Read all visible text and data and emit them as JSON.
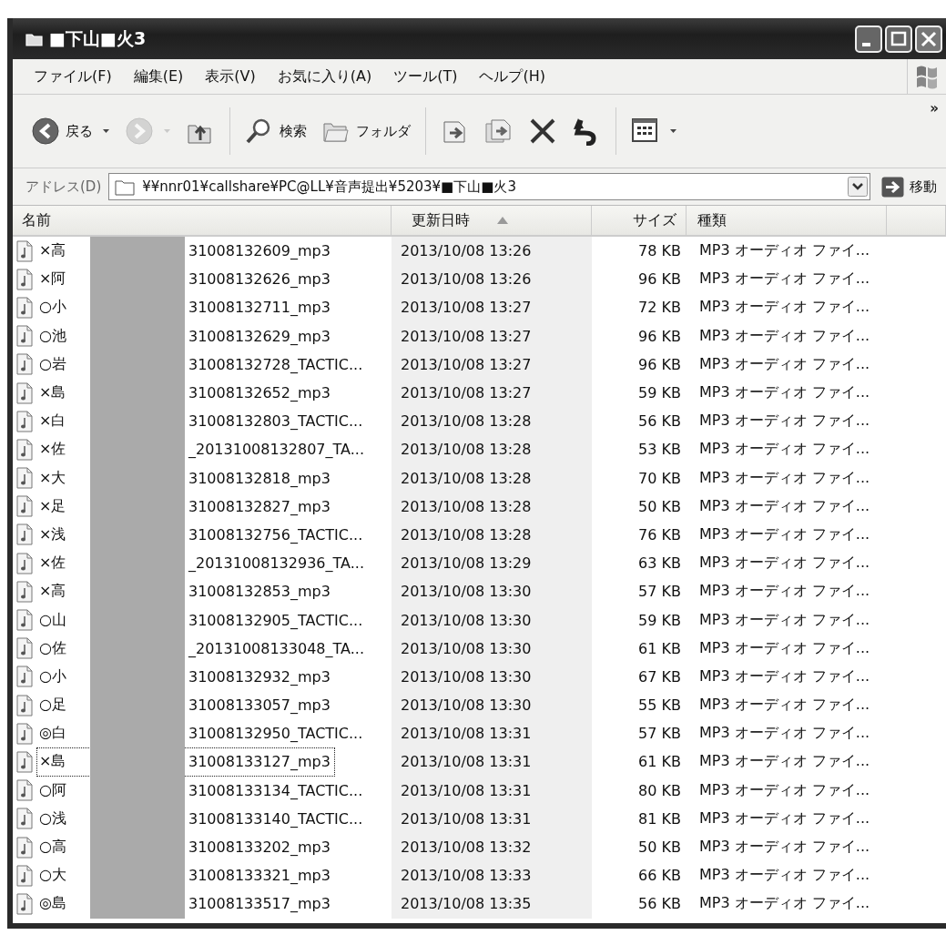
{
  "window": {
    "title": "■下山■火3"
  },
  "menu": [
    {
      "label": "ファイル(F)"
    },
    {
      "label": "編集(E)"
    },
    {
      "label": "表示(V)"
    },
    {
      "label": "お気に入り(A)"
    },
    {
      "label": "ツール(T)"
    },
    {
      "label": "ヘルプ(H)"
    }
  ],
  "toolbar": {
    "buttons": [
      {
        "kind": "back",
        "label": "戻る",
        "disabled": false
      },
      {
        "kind": "forward",
        "disabled": true
      },
      {
        "kind": "up",
        "disabled": false
      },
      {
        "kind": "separator"
      },
      {
        "kind": "search",
        "label": "検索",
        "disabled": false
      },
      {
        "kind": "folders",
        "label": "フォルダ",
        "disabled": false
      },
      {
        "kind": "separator"
      },
      {
        "kind": "move",
        "disabled": false
      },
      {
        "kind": "copy",
        "disabled": false
      },
      {
        "kind": "delete",
        "disabled": false
      },
      {
        "kind": "undo",
        "disabled": false
      },
      {
        "kind": "separator"
      },
      {
        "kind": "views",
        "disabled": false
      }
    ],
    "overflow": "»"
  },
  "address_bar": {
    "label": "アドレス(D)",
    "path": "¥¥nnr01¥callshare¥PC@LL¥音声提出¥5203¥■下山■火3",
    "go_label": "移動"
  },
  "table": {
    "columns": [
      {
        "label": "名前",
        "sorted": false
      },
      {
        "label": "更新日時",
        "sorted": true
      },
      {
        "label": "サイズ",
        "sorted": false
      },
      {
        "label": "種類",
        "sorted": false
      }
    ],
    "rows": [
      {
        "name_start": "×高",
        "name_end": "31008132609_mp3",
        "modified": "2013/10/08 13:26",
        "size": "78 KB",
        "type": "MP3 オーディオ ファイ...",
        "focused": false
      },
      {
        "name_start": "×阿",
        "name_end": "31008132626_mp3",
        "modified": "2013/10/08 13:26",
        "size": "96 KB",
        "type": "MP3 オーディオ ファイ...",
        "focused": false
      },
      {
        "name_start": "○小",
        "name_end": "31008132711_mp3",
        "modified": "2013/10/08 13:27",
        "size": "72 KB",
        "type": "MP3 オーディオ ファイ...",
        "focused": false
      },
      {
        "name_start": "○池",
        "name_end": "31008132629_mp3",
        "modified": "2013/10/08 13:27",
        "size": "96 KB",
        "type": "MP3 オーディオ ファイ...",
        "focused": false
      },
      {
        "name_start": "○岩",
        "name_end": "31008132728_TACTIC...",
        "modified": "2013/10/08 13:27",
        "size": "96 KB",
        "type": "MP3 オーディオ ファイ...",
        "focused": false
      },
      {
        "name_start": "×島",
        "name_end": "31008132652_mp3",
        "modified": "2013/10/08 13:27",
        "size": "59 KB",
        "type": "MP3 オーディオ ファイ...",
        "focused": false
      },
      {
        "name_start": "×白",
        "name_end": "31008132803_TACTIC...",
        "modified": "2013/10/08 13:28",
        "size": "56 KB",
        "type": "MP3 オーディオ ファイ...",
        "focused": false
      },
      {
        "name_start": "×佐",
        "name_end": "_20131008132807_TA...",
        "modified": "2013/10/08 13:28",
        "size": "53 KB",
        "type": "MP3 オーディオ ファイ...",
        "focused": false
      },
      {
        "name_start": "×大",
        "name_end": "31008132818_mp3",
        "modified": "2013/10/08 13:28",
        "size": "70 KB",
        "type": "MP3 オーディオ ファイ...",
        "focused": false
      },
      {
        "name_start": "×足",
        "name_end": "31008132827_mp3",
        "modified": "2013/10/08 13:28",
        "size": "50 KB",
        "type": "MP3 オーディオ ファイ...",
        "focused": false
      },
      {
        "name_start": "×浅",
        "name_end": "31008132756_TACTIC...",
        "modified": "2013/10/08 13:28",
        "size": "76 KB",
        "type": "MP3 オーディオ ファイ...",
        "focused": false
      },
      {
        "name_start": "×佐",
        "name_end": "_20131008132936_TA...",
        "modified": "2013/10/08 13:29",
        "size": "63 KB",
        "type": "MP3 オーディオ ファイ...",
        "focused": false
      },
      {
        "name_start": "×高",
        "name_end": "31008132853_mp3",
        "modified": "2013/10/08 13:30",
        "size": "57 KB",
        "type": "MP3 オーディオ ファイ...",
        "focused": false
      },
      {
        "name_start": "○山",
        "name_end": "31008132905_TACTIC...",
        "modified": "2013/10/08 13:30",
        "size": "59 KB",
        "type": "MP3 オーディオ ファイ...",
        "focused": false
      },
      {
        "name_start": "○佐",
        "name_end": "_20131008133048_TA...",
        "modified": "2013/10/08 13:30",
        "size": "61 KB",
        "type": "MP3 オーディオ ファイ...",
        "focused": false
      },
      {
        "name_start": "○小",
        "name_end": "31008132932_mp3",
        "modified": "2013/10/08 13:30",
        "size": "67 KB",
        "type": "MP3 オーディオ ファイ...",
        "focused": false
      },
      {
        "name_start": "○足",
        "name_end": "31008133057_mp3",
        "modified": "2013/10/08 13:30",
        "size": "55 KB",
        "type": "MP3 オーディオ ファイ...",
        "focused": false
      },
      {
        "name_start": "◎白",
        "name_end": "31008132950_TACTIC...",
        "modified": "2013/10/08 13:31",
        "size": "57 KB",
        "type": "MP3 オーディオ ファイ...",
        "focused": false
      },
      {
        "name_start": "×島",
        "name_end": "31008133127_mp3",
        "modified": "2013/10/08 13:31",
        "size": "61 KB",
        "type": "MP3 オーディオ ファイ...",
        "focused": true
      },
      {
        "name_start": "○阿",
        "name_end": "31008133134_TACTIC...",
        "modified": "2013/10/08 13:31",
        "size": "80 KB",
        "type": "MP3 オーディオ ファイ...",
        "focused": false
      },
      {
        "name_start": "○浅",
        "name_end": "31008133140_TACTIC...",
        "modified": "2013/10/08 13:31",
        "size": "81 KB",
        "type": "MP3 オーディオ ファイ...",
        "focused": false
      },
      {
        "name_start": "○高",
        "name_end": "31008133202_mp3",
        "modified": "2013/10/08 13:32",
        "size": "50 KB",
        "type": "MP3 オーディオ ファイ...",
        "focused": false
      },
      {
        "name_start": "○大",
        "name_end": "31008133321_mp3",
        "modified": "2013/10/08 13:33",
        "size": "66 KB",
        "type": "MP3 オーディオ ファイ...",
        "focused": false
      },
      {
        "name_start": "◎島",
        "name_end": "31008133517_mp3",
        "modified": "2013/10/08 13:35",
        "size": "56 KB",
        "type": "MP3 オーディオ ファイ...",
        "focused": false
      }
    ]
  }
}
